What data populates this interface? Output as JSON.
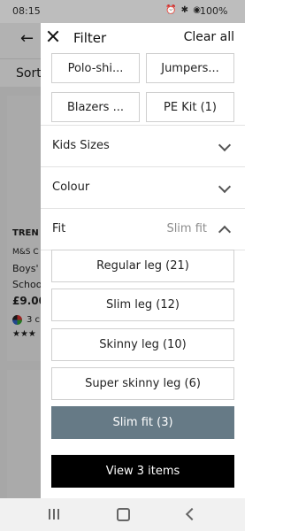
{
  "status_bar": {
    "time": "08:15",
    "battery": "100%"
  },
  "background": {
    "sort_label": "Sort",
    "card_brand": "TREN",
    "card_sub": "M&S C",
    "card_title_1": "Boys'",
    "card_title_2": "Schoo",
    "card_price": "£9.00",
    "card_colours": "3 c",
    "card_rating": "★★★"
  },
  "filter": {
    "title": "Filter",
    "clear_all": "Clear all",
    "chips": [
      "Polo-shi...",
      "Jumpers...",
      "Blazers ...",
      "PE Kit (1)"
    ],
    "sections": [
      {
        "label": "Kids Sizes",
        "value": ""
      },
      {
        "label": "Colour",
        "value": ""
      },
      {
        "label": "Fit",
        "value": "Slim fit"
      }
    ],
    "fit_options": [
      {
        "label": "Regular leg (21)",
        "selected": false
      },
      {
        "label": "Slim leg (12)",
        "selected": false
      },
      {
        "label": "Skinny leg (10)",
        "selected": false
      },
      {
        "label": "Super skinny leg (6)",
        "selected": false
      },
      {
        "label": "Slim fit (3)",
        "selected": true
      }
    ],
    "view_button": "View 3 items"
  },
  "colors": {
    "selected_option": "#667a86",
    "primary_button": "#000000"
  }
}
